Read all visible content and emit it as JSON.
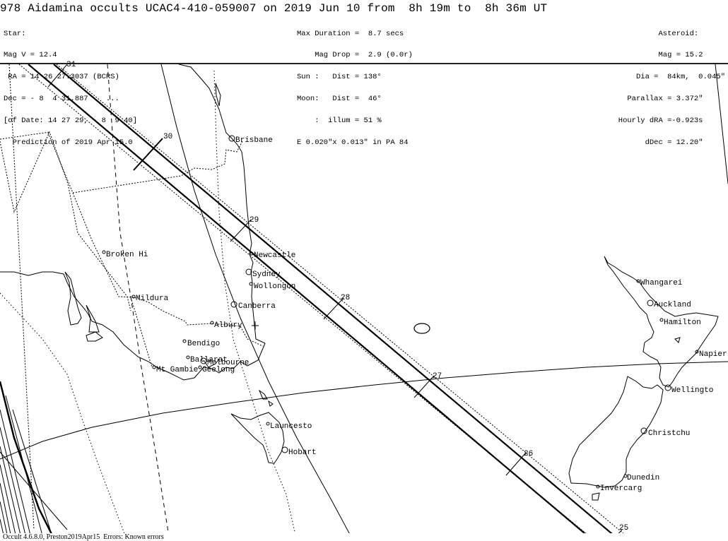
{
  "header": {
    "title": "978 Aidamina occults UCAC4-410-059007 on 2019 Jun 10 from  8h 19m to  8h 36m UT",
    "star": [
      "Star:",
      "Mag V = 12.4",
      " RA = 14 26 27.3037 (BCRS)",
      "Dec = - 8  4 31.887    ...",
      "[of Date: 14 27 29, - 8  9 40]",
      "  Prediction of 2019 Apr 15.0"
    ],
    "event": [
      "Max Duration =  8.7 secs",
      "    Mag Drop =  2.9 (0.0r)",
      "Sun :   Dist = 138°",
      "Moon:   Dist =  46°",
      "    :  illum = 51 %",
      "E 0.020\"x 0.013\" in PA 84"
    ],
    "asteroid": [
      "Asteroid:      ",
      "Mag = 15.2     ",
      "Dia =  84km,  0.045\"",
      "Parallax = 3.372\"     ",
      "Hourly dRA =-0.923s     ",
      "dDec = 12.20\"     "
    ]
  },
  "map": {
    "path_time_ticks": [
      "31",
      "30",
      "29",
      "28",
      "27",
      "26",
      "25"
    ],
    "cities": [
      {
        "name": "Brisbane"
      },
      {
        "name": "Broken Hi"
      },
      {
        "name": "Newcastle"
      },
      {
        "name": "Sydney"
      },
      {
        "name": "Wollongon"
      },
      {
        "name": "Mildura"
      },
      {
        "name": "Canberra"
      },
      {
        "name": "Albury"
      },
      {
        "name": "Bendigo"
      },
      {
        "name": "Ballarat"
      },
      {
        "name": "Melbourne"
      },
      {
        "name": "Mt Gambie"
      },
      {
        "name": "Geelong"
      },
      {
        "name": "Launcesto"
      },
      {
        "name": "Hobart"
      },
      {
        "name": "Whangarei"
      },
      {
        "name": "Auckland"
      },
      {
        "name": "Hamilton"
      },
      {
        "name": "Napier"
      },
      {
        "name": "Wellingto"
      },
      {
        "name": "Christchu"
      },
      {
        "name": "Dunedin"
      },
      {
        "name": "Invercarg"
      }
    ]
  },
  "footer": {
    "text": "Occult 4.6.8.0, Preston2019Apr15  Errors: Known errors"
  }
}
